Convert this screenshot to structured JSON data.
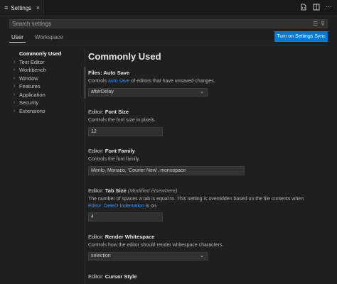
{
  "tab": {
    "icon": "settings-list-icon",
    "label": "Settings",
    "close": "×"
  },
  "search": {
    "placeholder": "Search settings"
  },
  "scopes": [
    "User",
    "Workspace"
  ],
  "sync_button": "Turn on Settings Sync",
  "toc": [
    "Commonly Used",
    "Text Editor",
    "Workbench",
    "Window",
    "Features",
    "Application",
    "Security",
    "Extensions"
  ],
  "page_title": "Commonly Used",
  "settings": {
    "auto_save": {
      "prefix": "Files: ",
      "name": "Auto Save",
      "desc_before": "Controls ",
      "desc_link": "auto save",
      "desc_after": " of editors that have unsaved changes.",
      "value": "afterDelay"
    },
    "font_size": {
      "prefix": "Editor: ",
      "name": "Font Size",
      "desc": "Controls the font size in pixels.",
      "value": "12"
    },
    "font_family": {
      "prefix": "Editor: ",
      "name": "Font Family",
      "desc": "Controls the font family.",
      "value": "Menlo, Monaco, 'Courier New', monospace"
    },
    "tab_size": {
      "prefix": "Editor: ",
      "name": "Tab Size",
      "modified": "(Modified elsewhere)",
      "desc_before": "The number of spaces a tab is equal to. This setting is overridden based on the file contents when ",
      "desc_link": "Editor: Detect Indentation",
      "desc_after": " is on.",
      "value": "4"
    },
    "render_whitespace": {
      "prefix": "Editor: ",
      "name": "Render Whitespace",
      "desc": "Controls how the editor should render whitespace characters.",
      "value": "selection"
    },
    "cursor_style": {
      "prefix": "Editor: ",
      "name": "Cursor Style"
    }
  },
  "colors": {
    "accent": "#0078d4",
    "link": "#3794ff",
    "background": "#1f1f1f"
  }
}
